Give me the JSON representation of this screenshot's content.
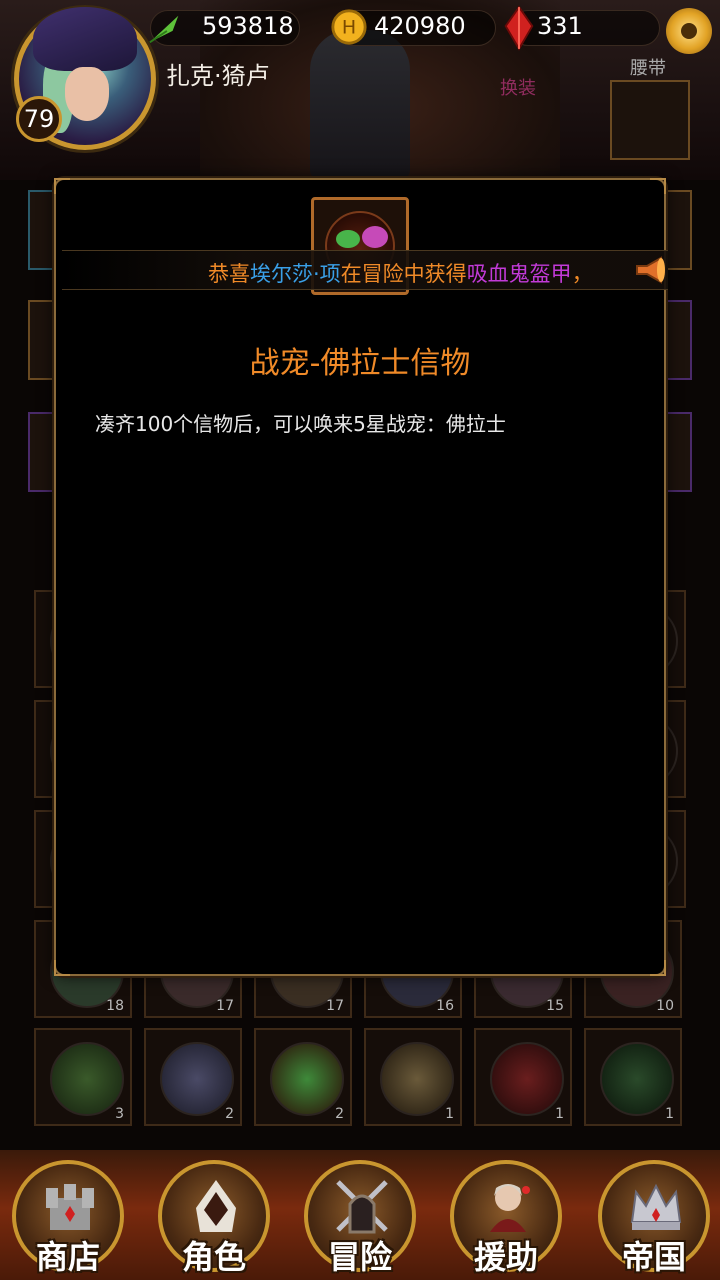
{
  "header": {
    "player_level": "79",
    "player_name": "扎克·猗卢",
    "stamina": "593818",
    "gold": "420980",
    "gems": "331",
    "icons": {
      "stamina": "green-feather-icon",
      "gold": "gold-coin-icon",
      "gems": "red-crystal-icon",
      "settings": "gear-icon"
    }
  },
  "equipment": {
    "belt_label": "腰带",
    "change_outfit": "换装"
  },
  "pet_grid": {
    "row1_counts": [
      "18",
      "17",
      "17",
      "16",
      "15",
      "10"
    ],
    "row2_counts": [
      "3",
      "2",
      "2",
      "1",
      "1",
      "1"
    ]
  },
  "broadcast": {
    "segments": [
      {
        "text": "恭喜",
        "color": "#f08a28"
      },
      {
        "text": "埃尔莎·项",
        "color": "#3aa0e8"
      },
      {
        "text": "在冒险中获得",
        "color": "#f08a28"
      },
      {
        "text": "吸血鬼盔甲",
        "color": "#c23ad8"
      },
      {
        "text": "，",
        "color": "#f08a28"
      }
    ]
  },
  "item_dialog": {
    "title": "战宠-佛拉士信物",
    "description": "凑齐100个信物后，可以唤来5星战宠：佛拉士"
  },
  "bottom_nav": {
    "items": [
      {
        "label": "商店",
        "icon": "castle-icon"
      },
      {
        "label": "角色",
        "icon": "hooded-figure-icon"
      },
      {
        "label": "冒险",
        "icon": "crossed-swords-gate-icon"
      },
      {
        "label": "援助",
        "icon": "helper-girl-icon"
      },
      {
        "label": "帝国",
        "icon": "crown-icon"
      }
    ]
  },
  "colors": {
    "accent_orange": "#f08a28",
    "frame_gold": "#c9962f",
    "name_blue": "#3aa0e8",
    "item_purple": "#c23ad8"
  }
}
